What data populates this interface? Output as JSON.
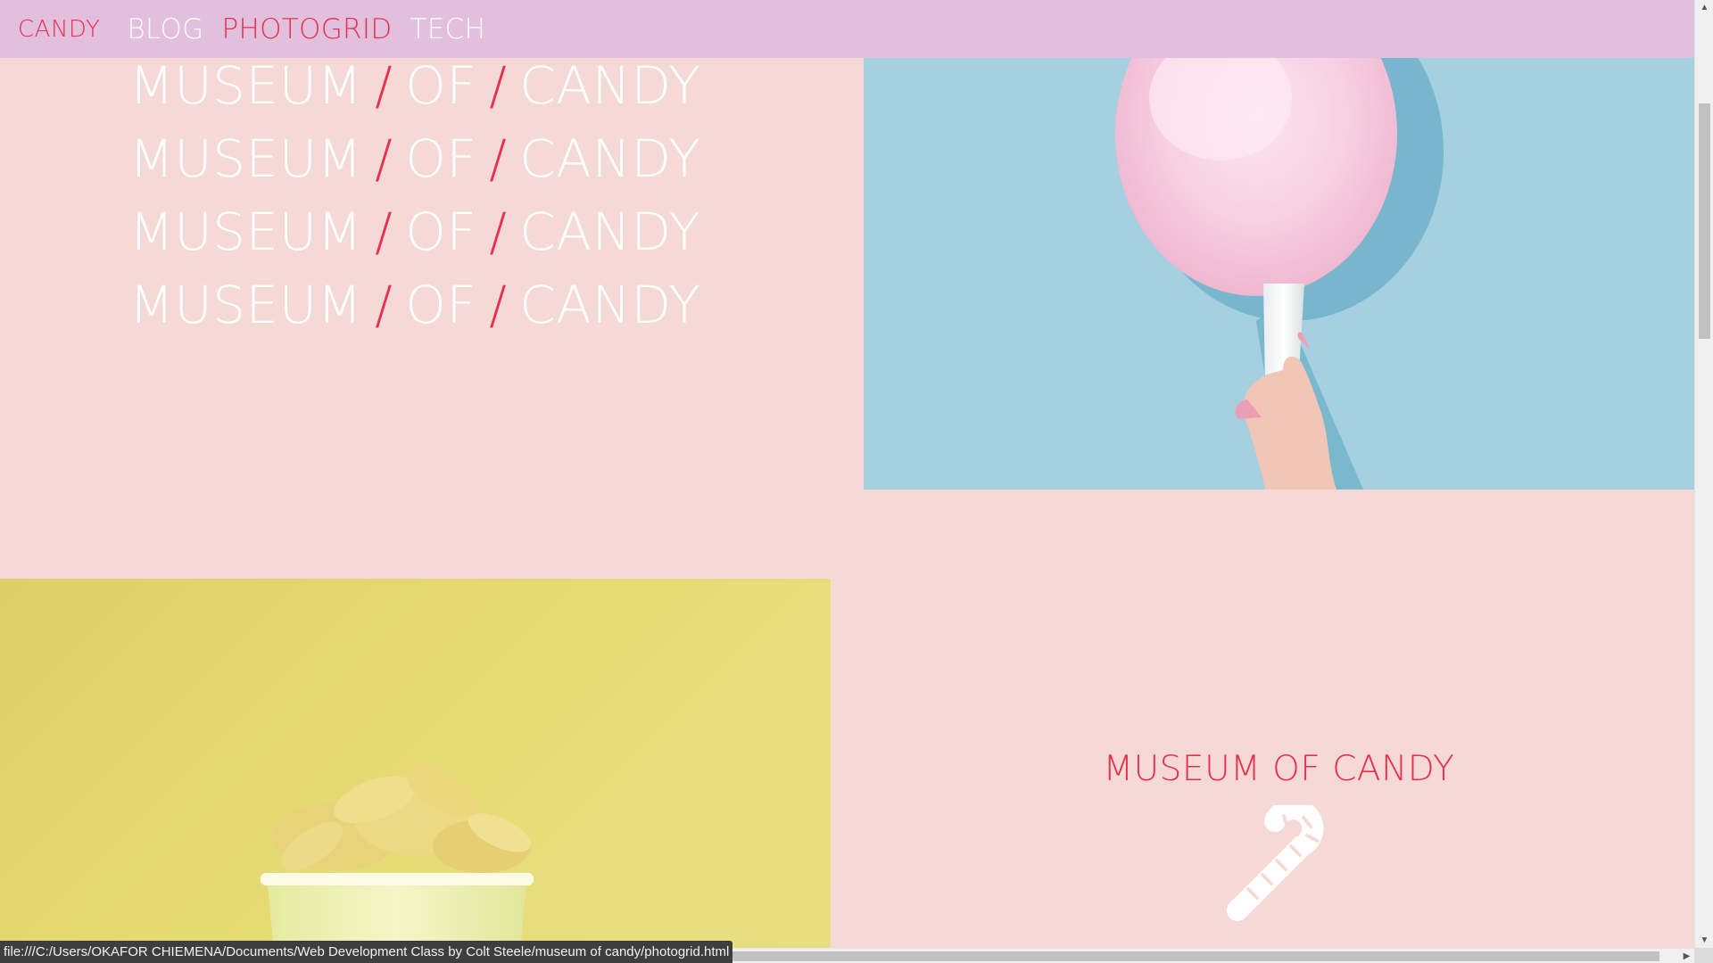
{
  "nav": {
    "brand": "CANDY",
    "links": [
      {
        "label": "BLOG",
        "active": false
      },
      {
        "label": "PHOTOGRID",
        "active": true
      },
      {
        "label": "TECH",
        "active": false
      }
    ]
  },
  "hero": {
    "words": [
      "MUSEUM",
      "/",
      "OF",
      "/",
      "CANDY"
    ]
  },
  "museum": {
    "title": "MUSEUM OF CANDY",
    "icon": "candy-cane-icon"
  },
  "images": {
    "cotton": "cotton-candy-photo",
    "banana": "banana-candy-photo"
  },
  "status": {
    "url": "file:///C:/Users/OKAFOR CHIEMENA/Documents/Web Development Class by Colt Steele/museum of candy/photogrid.html"
  },
  "colors": {
    "background": "#f5d9d6",
    "nav": "#e1bfdd",
    "accent": "#e8304d",
    "sky": "#a6cfe0",
    "lemon": "#e2d671"
  }
}
